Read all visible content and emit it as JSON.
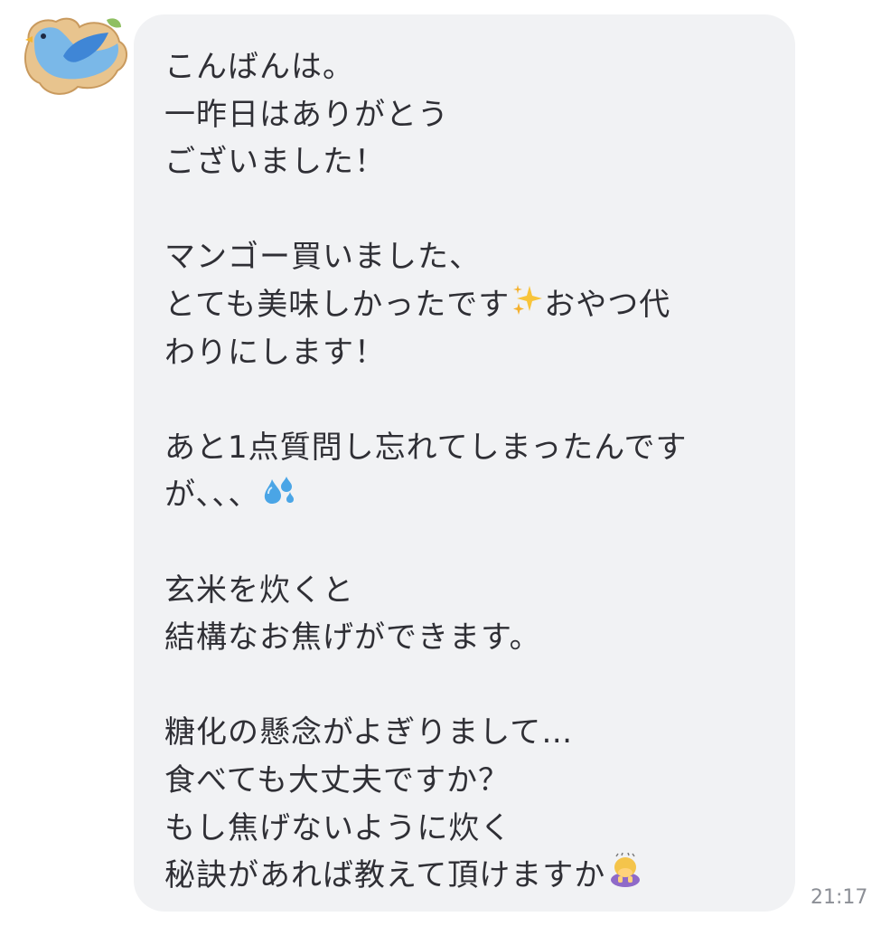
{
  "sender": {
    "avatar_icon": "blue-bird-icon"
  },
  "message": {
    "lines": [
      "こんばんは。",
      "一昨日はありがとう",
      "ございました！",
      "",
      "マンゴー買いました、",
      "とても美味しかったです",
      "わりにします！",
      "",
      "あと1点質問し忘れてしまったんです",
      "が、、、",
      "",
      "玄米を炊くと",
      "結構なお焦げができます。",
      "",
      "糖化の懸念がよぎりまして…",
      "食べても大丈夫ですか？",
      "もし焦げないように炊く",
      "秘訣があれば教えて頂けますか"
    ],
    "line6_after_emoji": "おやつ代",
    "emojis": {
      "sparkles": "sparkles-emoji",
      "sweat_droplets": "sweat-droplets-emoji",
      "bowing_person": "bowing-woman-emoji"
    },
    "bubble_color": "#f1f2f4",
    "text_color": "#2f2f35"
  },
  "timestamp": "21:17"
}
